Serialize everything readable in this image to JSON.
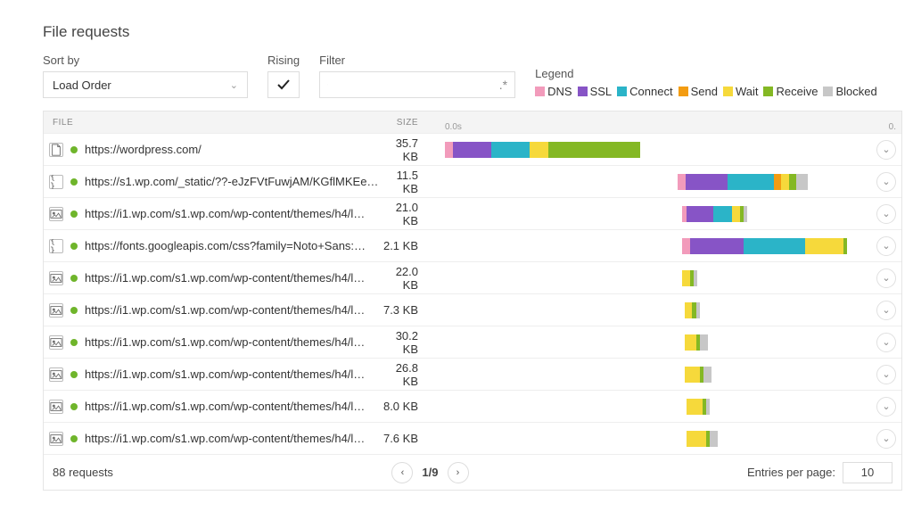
{
  "title": "File requests",
  "controls": {
    "sort_label": "Sort by",
    "sort_value": "Load Order",
    "rising_label": "Rising",
    "filter_label": "Filter",
    "legend_label": "Legend"
  },
  "legend": [
    {
      "name": "DNS",
      "color": "#f29bbb"
    },
    {
      "name": "SSL",
      "color": "#8754c6"
    },
    {
      "name": "Connect",
      "color": "#2bb4c8"
    },
    {
      "name": "Send",
      "color": "#f39c12"
    },
    {
      "name": "Wait",
      "color": "#f6d93b"
    },
    {
      "name": "Receive",
      "color": "#84b824"
    },
    {
      "name": "Blocked",
      "color": "#c7c7c7"
    }
  ],
  "columns": {
    "file": "FILE",
    "size": "SIZE"
  },
  "timeline": {
    "start": "0.0s",
    "end": "0."
  },
  "rows": [
    {
      "icon": "doc",
      "url": "https://wordpress.com/",
      "size": "35.7 KB",
      "offset": 0,
      "segs": [
        {
          "c": "c-dns",
          "w": 2
        },
        {
          "c": "c-ssl",
          "w": 10
        },
        {
          "c": "c-connect",
          "w": 10
        },
        {
          "c": "c-wait",
          "w": 5
        },
        {
          "c": "c-receive",
          "w": 24
        }
      ]
    },
    {
      "icon": "code",
      "url": "https://s1.wp.com/_static/??-eJzFVtFuwjAM/KGflMKEe…",
      "size": "11.5 KB",
      "offset": 51,
      "segs": [
        {
          "c": "c-dns",
          "w": 2
        },
        {
          "c": "c-ssl",
          "w": 11
        },
        {
          "c": "c-connect",
          "w": 12
        },
        {
          "c": "c-send",
          "w": 2
        },
        {
          "c": "c-wait",
          "w": 2
        },
        {
          "c": "c-receive",
          "w": 2
        },
        {
          "c": "c-blocked",
          "w": 3
        }
      ]
    },
    {
      "icon": "img",
      "url": "https://i1.wp.com/s1.wp.com/wp-content/themes/h4/l…",
      "size": "21.0 KB",
      "offset": 52,
      "segs": [
        {
          "c": "c-dns",
          "w": 1
        },
        {
          "c": "c-ssl",
          "w": 7
        },
        {
          "c": "c-connect",
          "w": 5
        },
        {
          "c": "c-wait",
          "w": 2
        },
        {
          "c": "c-receive",
          "w": 1
        },
        {
          "c": "c-blocked",
          "w": 1
        }
      ]
    },
    {
      "icon": "code",
      "url": "https://fonts.googleapis.com/css?family=Noto+Sans:…",
      "size": "2.1 KB",
      "offset": 52,
      "segs": [
        {
          "c": "c-dns",
          "w": 2
        },
        {
          "c": "c-ssl",
          "w": 14
        },
        {
          "c": "c-connect",
          "w": 16
        },
        {
          "c": "c-wait",
          "w": 10
        },
        {
          "c": "c-receive",
          "w": 1
        }
      ]
    },
    {
      "icon": "img",
      "url": "https://i1.wp.com/s1.wp.com/wp-content/themes/h4/l…",
      "size": "22.0 KB",
      "offset": 52,
      "segs": [
        {
          "c": "c-wait",
          "w": 2
        },
        {
          "c": "c-receive",
          "w": 1
        },
        {
          "c": "c-blocked",
          "w": 1
        }
      ]
    },
    {
      "icon": "img",
      "url": "https://i1.wp.com/s1.wp.com/wp-content/themes/h4/l…",
      "size": "7.3 KB",
      "offset": 52.5,
      "segs": [
        {
          "c": "c-wait",
          "w": 2
        },
        {
          "c": "c-receive",
          "w": 1
        },
        {
          "c": "c-blocked",
          "w": 1
        }
      ]
    },
    {
      "icon": "img",
      "url": "https://i1.wp.com/s1.wp.com/wp-content/themes/h4/l…",
      "size": "30.2 KB",
      "offset": 52.5,
      "segs": [
        {
          "c": "c-wait",
          "w": 3
        },
        {
          "c": "c-receive",
          "w": 1
        },
        {
          "c": "c-blocked",
          "w": 2
        }
      ]
    },
    {
      "icon": "img",
      "url": "https://i1.wp.com/s1.wp.com/wp-content/themes/h4/l…",
      "size": "26.8 KB",
      "offset": 52.5,
      "segs": [
        {
          "c": "c-wait",
          "w": 4
        },
        {
          "c": "c-receive",
          "w": 1
        },
        {
          "c": "c-blocked",
          "w": 2
        }
      ]
    },
    {
      "icon": "img",
      "url": "https://i1.wp.com/s1.wp.com/wp-content/themes/h4/l…",
      "size": "8.0 KB",
      "offset": 53,
      "segs": [
        {
          "c": "c-wait",
          "w": 4
        },
        {
          "c": "c-receive",
          "w": 1
        },
        {
          "c": "c-blocked",
          "w": 1
        }
      ]
    },
    {
      "icon": "img",
      "url": "https://i1.wp.com/s1.wp.com/wp-content/themes/h4/l…",
      "size": "7.6 KB",
      "offset": 53,
      "segs": [
        {
          "c": "c-wait",
          "w": 5
        },
        {
          "c": "c-receive",
          "w": 1
        },
        {
          "c": "c-blocked",
          "w": 2
        }
      ]
    }
  ],
  "footer": {
    "total": "88 requests",
    "page": "1/9",
    "epp_label": "Entries per page:",
    "epp_value": "10"
  }
}
